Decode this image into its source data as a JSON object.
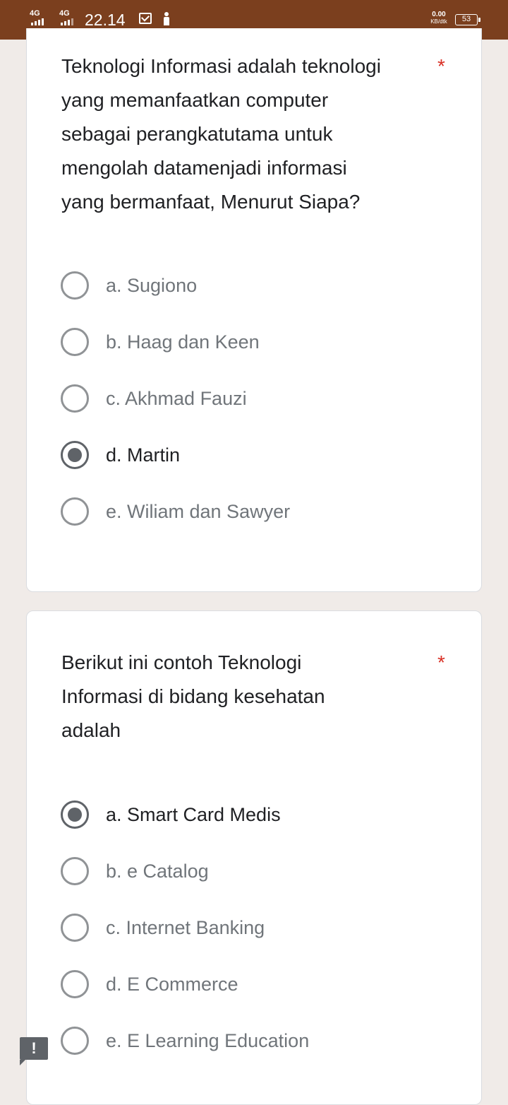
{
  "status_bar": {
    "network1": "4G",
    "network2": "4G",
    "time": "22.14",
    "speed_value": "0.00",
    "speed_unit": "KB/dtk",
    "battery": "53"
  },
  "questions": [
    {
      "title": "Teknologi Informasi adalah teknologi\nyang memanfaatkan computer\nsebagai perangkatutama untuk\nmengolah datamenjadi informasi\nyang bermanfaat, Menurut Siapa?",
      "required_mark": "*",
      "options": [
        {
          "label": "a. Sugiono",
          "selected": false
        },
        {
          "label": "b. Haag dan Keen",
          "selected": false
        },
        {
          "label": "c. Akhmad Fauzi",
          "selected": false
        },
        {
          "label": "d. Martin",
          "selected": true
        },
        {
          "label": "e. Wiliam dan Sawyer",
          "selected": false
        }
      ]
    },
    {
      "title": "Berikut ini contoh Teknologi\nInformasi di bidang kesehatan\nadalah",
      "required_mark": "*",
      "options": [
        {
          "label": "a. Smart Card Medis",
          "selected": true
        },
        {
          "label": "b. e Catalog",
          "selected": false
        },
        {
          "label": "c. Internet Banking",
          "selected": false
        },
        {
          "label": "d. E Commerce",
          "selected": false
        },
        {
          "label": "e. E Learning Education",
          "selected": false
        }
      ]
    }
  ],
  "warning_badge": "!"
}
